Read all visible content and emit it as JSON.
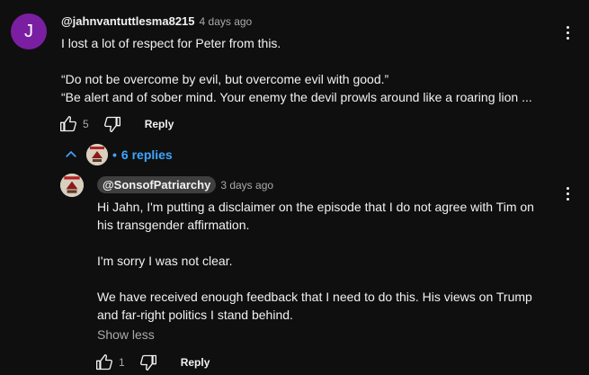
{
  "comment": {
    "avatar_letter": "J",
    "author": "@jahnvantuttlesma8215",
    "time": "4 days ago",
    "lines": [
      "I lost a lot of respect for Peter from this.",
      "",
      "“Do not be overcome by evil, but overcome evil with good.”",
      "“Be alert and of sober mind. Your enemy the devil prowls around like a roaring lion ..."
    ],
    "like_count": "5",
    "reply_label": "Reply",
    "replies_label": "6 replies",
    "replies_dot": "•"
  },
  "reply": {
    "author": "@SonsofPatriarchy",
    "time": "3 days ago",
    "lines": [
      "Hi Jahn, I'm putting a disclaimer on the episode that I do not agree with Tim on",
      "his transgender affirmation.",
      "",
      "I'm sorry I was not clear.",
      "",
      "We have received enough feedback that I need to do this. His views on Trump",
      "and far-right politics I stand behind."
    ],
    "show_less_label": "Show less",
    "like_count": "1",
    "reply_label": "Reply"
  },
  "colors": {
    "background": "#0f0f0f",
    "link_blue": "#3ea6ff",
    "avatar_purple": "#7b1fa2",
    "chip_bg": "#3f3f3f"
  },
  "icons": [
    "more-vert-icon",
    "thumb-up-icon",
    "thumb-down-icon",
    "chevron-up-icon"
  ]
}
